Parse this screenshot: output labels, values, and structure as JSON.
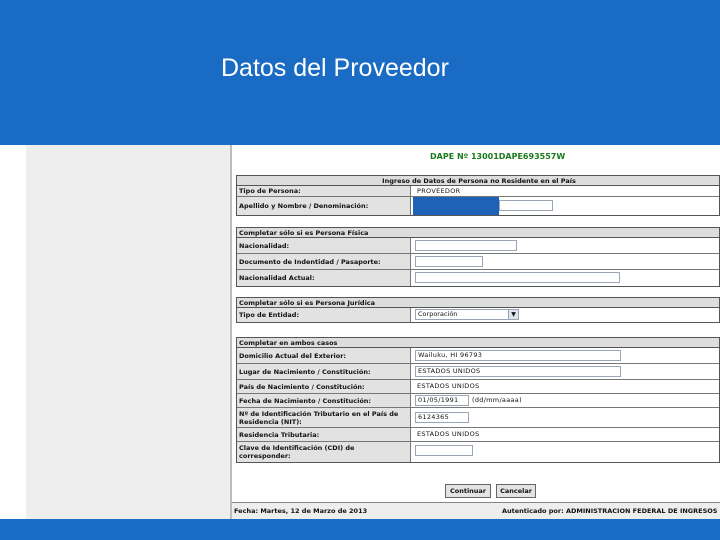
{
  "slide": {
    "title": "Datos del Proveedor",
    "colors": {
      "header": "#1a6bc4",
      "footer": "#1a6bc4",
      "doc_id": "#1a7a1a"
    }
  },
  "form": {
    "doc_id": "DAPE Nº 13001DAPE693557W",
    "main_section": {
      "title": "Ingreso de Datos de Persona no Residente en el País",
      "rows": [
        {
          "label": "Tipo de Persona:",
          "value": "PROVEEDOR"
        },
        {
          "label": "Apellido y Nombre / Denominación:",
          "value": ""
        }
      ]
    },
    "fisica_section": {
      "title": "Completar sólo si es Persona Física",
      "rows": [
        {
          "label": "Nacionalidad:",
          "value": ""
        },
        {
          "label": "Documento de Indentidad / Pasaporte:",
          "value": ""
        },
        {
          "label": "Nacionalidad Actual:",
          "value": ""
        }
      ]
    },
    "juridica_section": {
      "title": "Completar sólo si es Persona Jurídica",
      "rows": [
        {
          "label": "Tipo de Entidad:",
          "value": "Corporación"
        }
      ]
    },
    "ambos_section": {
      "title": "Completar en ambos casos",
      "rows": [
        {
          "label": "Domicilio Actual del Exterior:",
          "value": "Wailuku, HI 96793"
        },
        {
          "label": "Lugar de Nacimiento / Constitución:",
          "value": "ESTADOS UNIDOS"
        },
        {
          "label": "País de Nacimiento / Constitución:",
          "value": "ESTADOS UNIDOS"
        },
        {
          "label": "Fecha de Nacimiento / Constitución:",
          "value": "01/05/1991",
          "hint": "(dd/mm/aaaa)"
        },
        {
          "label": "Nº de Identificación Tributario en el País de Residencia (NIT):",
          "value": "6124365"
        },
        {
          "label": "Residencia Tributaria:",
          "value": "ESTADOS UNIDOS"
        },
        {
          "label": "Clave de Identificación (CDI) de corresponder:",
          "value": ""
        }
      ]
    },
    "buttons": {
      "continue": "Continuar",
      "cancel": "Cancelar"
    },
    "status": {
      "date": "Fecha: Martes, 12 de Marzo de 2013",
      "auth": "Autenticado por: ADMINISTRACION FEDERAL DE INGRESOS"
    }
  }
}
